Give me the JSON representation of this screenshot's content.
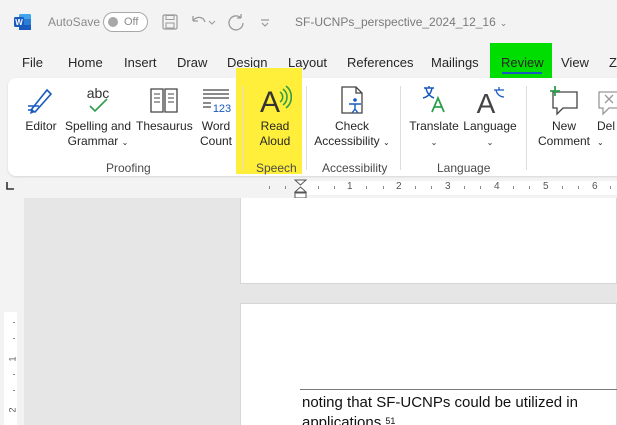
{
  "titlebar": {
    "autosave_label": "AutoSave",
    "autosave_state": "Off",
    "document_title": "SF-UCNPs_perspective_2024_12_16",
    "title_chevron": "⌄",
    "word_icon": "word-logo",
    "quick_icons": [
      "save-icon",
      "undo-icon",
      "redo-icon",
      "customize-icon"
    ]
  },
  "tabs": [
    {
      "label": "File"
    },
    {
      "label": "Home"
    },
    {
      "label": "Insert"
    },
    {
      "label": "Draw"
    },
    {
      "label": "Design"
    },
    {
      "label": "Layout"
    },
    {
      "label": "References"
    },
    {
      "label": "Mailings"
    },
    {
      "label": "Review",
      "active": true
    },
    {
      "label": "View"
    },
    {
      "label": "Z"
    }
  ],
  "ribbon": {
    "proofing": {
      "group_label": "Proofing",
      "editor": {
        "label": "Editor"
      },
      "spelling": {
        "label_1": "Spelling and",
        "label_2": "Grammar",
        "icon_text": "abc"
      },
      "thesaurus": {
        "label": "Thesaurus"
      },
      "word_count": {
        "label_1": "Word",
        "label_2": "Count",
        "icon_text": "123"
      }
    },
    "speech": {
      "group_label": "Speech",
      "read_aloud": {
        "label_1": "Read",
        "label_2": "Aloud",
        "icon_text": "A"
      }
    },
    "accessibility": {
      "group_label": "Accessibility",
      "check": {
        "label_1": "Check",
        "label_2": "Accessibility"
      }
    },
    "language": {
      "group_label": "Language",
      "translate": {
        "label": "Translate"
      },
      "language": {
        "label": "Language",
        "icon_text": "A"
      }
    },
    "comments": {
      "new_comment": {
        "label_1": "New",
        "label_2": "Comment"
      },
      "delete": {
        "label": "Del"
      }
    }
  },
  "ruler": {
    "numbers": [
      "1",
      "1",
      "2",
      "3",
      "4",
      "5",
      "6"
    ],
    "vertical_numbers": [
      "1",
      "2"
    ]
  },
  "document": {
    "line1": "noting that SF-UCNPs could be utilized in",
    "line2": "applications",
    "citation": "51"
  },
  "colors": {
    "review_highlight": "#00dd00",
    "speech_highlight": "#ffef3a",
    "word_blue": "#185abd"
  }
}
